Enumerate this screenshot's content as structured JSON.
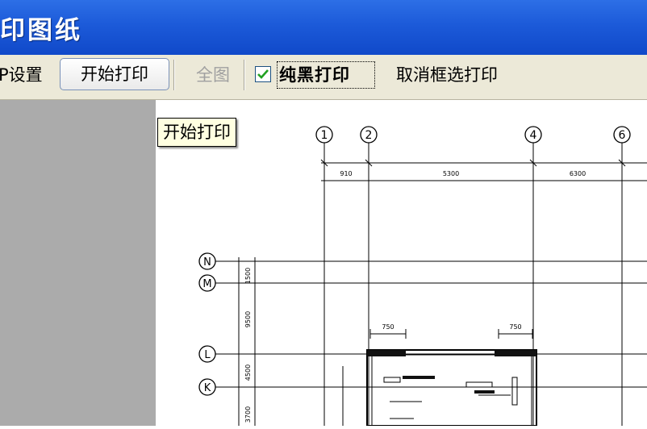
{
  "window": {
    "title": "印图纸"
  },
  "toolbar": {
    "print_setup_label": "P设置",
    "start_print_label": "开始打印",
    "full_view_label": "全图",
    "pure_black_label": "纯黑打印",
    "pure_black_checked": true,
    "cancel_select_label": "取消框选打印"
  },
  "tooltip": {
    "text": "开始打印"
  },
  "drawing": {
    "axis_labels_top": [
      "1",
      "2",
      "4",
      "6"
    ],
    "axis_labels_left": [
      "N",
      "M",
      "L",
      "K"
    ],
    "top_dims": [
      "910",
      "5300",
      "6300"
    ],
    "detail_dims": [
      "750",
      "750"
    ],
    "side_dims": [
      "1500",
      "9500",
      "4500",
      "3700"
    ]
  }
}
